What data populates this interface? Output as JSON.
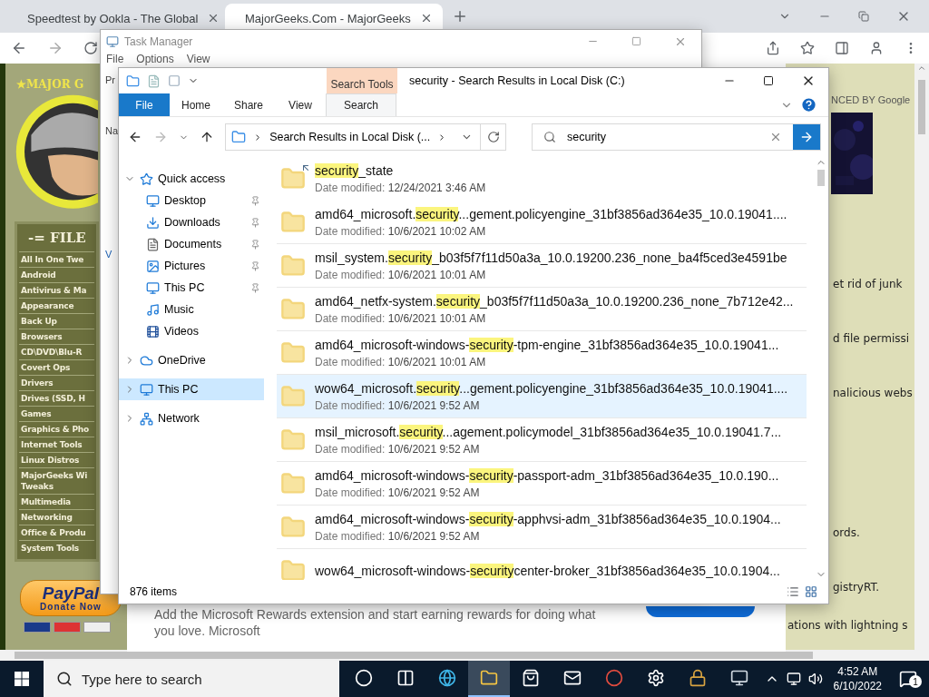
{
  "browser": {
    "tabs": [
      {
        "title": "Speedtest by Ookla - The Global",
        "selected": false
      },
      {
        "title": "MajorGeeks.Com - MajorGeeks",
        "selected": true
      }
    ]
  },
  "website": {
    "logo_text": "★MAJOR G",
    "menu_heading": "-= FILE",
    "categories": [
      "All In One Twe",
      "Android",
      "Antivirus & Ma",
      "Appearance",
      "Back Up",
      "Browsers",
      "CD\\DVD\\Blu-R",
      "Covert Ops",
      "Drivers",
      "Drives (SSD, H",
      "Games",
      "Graphics & Pho",
      "Internet Tools",
      "Linux Distros",
      "MajorGeeks Wi\nTweaks",
      "Multimedia",
      "Networking",
      "Office & Produ",
      "System Tools"
    ],
    "donate": {
      "brand": "PayPal",
      "label": "Donate Now"
    },
    "ad_label": "NCED BY Google",
    "snippets": [
      "et rid of junk",
      "d file permissi",
      "nalicious webs",
      "ords.",
      "gistryRT.",
      "ations with lightning s"
    ]
  },
  "rewards_banner": {
    "text": "Add the Microsoft Rewards extension and start earning rewards for doing what you love. Microsoft"
  },
  "task_manager": {
    "title": "Task Manager",
    "menu": [
      "File",
      "Options",
      "View"
    ],
    "fragments": [
      "Pr",
      "Na",
      "V"
    ]
  },
  "explorer": {
    "title": "security - Search Results in Local Disk (C:)",
    "context_tab": "Search Tools",
    "ribbon_tabs": [
      {
        "label": "File",
        "kind": "file",
        "selected": false
      },
      {
        "label": "Home",
        "kind": "tab",
        "selected": false
      },
      {
        "label": "Share",
        "kind": "tab",
        "selected": false
      },
      {
        "label": "View",
        "kind": "tab",
        "selected": false
      },
      {
        "label": "Search",
        "kind": "context",
        "selected": true
      }
    ],
    "address": "Search Results in Local Disk (...",
    "search": {
      "value": "security"
    },
    "nav": [
      {
        "label": "Quick access",
        "kind": "star",
        "expanded": true,
        "selected": false,
        "children": [
          {
            "label": "Desktop",
            "kind": "desktop",
            "pinned": true,
            "selected": false
          },
          {
            "label": "Downloads",
            "kind": "download",
            "pinned": true,
            "selected": false
          },
          {
            "label": "Documents",
            "kind": "document",
            "pinned": true,
            "selected": false
          },
          {
            "label": "Pictures",
            "kind": "picture",
            "pinned": true,
            "selected": false
          },
          {
            "label": "This PC",
            "kind": "pc",
            "pinned": true,
            "selected": false
          },
          {
            "label": "Music",
            "kind": "music",
            "pinned": false,
            "selected": false
          },
          {
            "label": "Videos",
            "kind": "video",
            "pinned": false,
            "selected": false
          }
        ]
      },
      {
        "label": "OneDrive",
        "kind": "cloud",
        "expanded": false,
        "selected": false
      },
      {
        "label": "This PC",
        "kind": "pc",
        "expanded": false,
        "selected": true
      },
      {
        "label": "Network",
        "kind": "network",
        "expanded": false,
        "selected": false
      }
    ],
    "files": [
      {
        "match": "security",
        "after": "_state",
        "date_label": "Date modified:",
        "date": "12/24/2021 3:46 AM",
        "kind": "shortcut",
        "selected": false
      },
      {
        "before": "amd64_microsoft.",
        "match": "security",
        "after": "...gement.policyengine_31bf3856ad364e35_10.0.19041....",
        "date_label": "Date modified:",
        "date": "10/6/2021 10:02 AM",
        "kind": "folder",
        "selected": false
      },
      {
        "before": "msil_system.",
        "match": "security",
        "after": "_b03f5f7f11d50a3a_10.0.19200.236_none_ba4f5ced3e4591be",
        "date_label": "Date modified:",
        "date": "10/6/2021 10:01 AM",
        "kind": "folder",
        "selected": false
      },
      {
        "before": "amd64_netfx-system.",
        "match": "security",
        "after": "_b03f5f7f11d50a3a_10.0.19200.236_none_7b712e42...",
        "date_label": "Date modified:",
        "date": "10/6/2021 10:01 AM",
        "kind": "folder",
        "selected": false
      },
      {
        "before": "amd64_microsoft-windows-",
        "match": "security",
        "after": "-tpm-engine_31bf3856ad364e35_10.0.19041...",
        "date_label": "Date modified:",
        "date": "10/6/2021 10:01 AM",
        "kind": "folder",
        "selected": false
      },
      {
        "before": "wow64_microsoft.",
        "match": "security",
        "after": "...gement.policyengine_31bf3856ad364e35_10.0.19041....",
        "date_label": "Date modified:",
        "date": "10/6/2021 9:52 AM",
        "kind": "folder",
        "selected": true
      },
      {
        "before": "msil_microsoft.",
        "match": "security",
        "after": "...agement.policymodel_31bf3856ad364e35_10.0.19041.7...",
        "date_label": "Date modified:",
        "date": "10/6/2021 9:52 AM",
        "kind": "folder",
        "selected": false
      },
      {
        "before": "amd64_microsoft-windows-",
        "match": "security",
        "after": "-passport-adm_31bf3856ad364e35_10.0.190...",
        "date_label": "Date modified:",
        "date": "10/6/2021 9:52 AM",
        "kind": "folder",
        "selected": false
      },
      {
        "before": "amd64_microsoft-windows-",
        "match": "security",
        "after": "-apphvsi-adm_31bf3856ad364e35_10.0.1904...",
        "date_label": "Date modified:",
        "date": "10/6/2021 9:52 AM",
        "kind": "folder",
        "selected": false
      },
      {
        "before": "wow64_microsoft-windows-",
        "match": "security",
        "after": "center-broker_31bf3856ad364e35_10.0.1904...",
        "kind": "folder",
        "selected": false
      }
    ],
    "status": "876 items"
  },
  "taskbar": {
    "search_placeholder": "Type here to search",
    "apps": [
      {
        "kind": "cortana",
        "active": false
      },
      {
        "kind": "taskview",
        "active": false
      },
      {
        "kind": "edge",
        "active": false
      },
      {
        "kind": "explorer",
        "active": true
      },
      {
        "kind": "store",
        "active": false
      },
      {
        "kind": "mail",
        "active": false
      },
      {
        "kind": "chrome",
        "active": false
      },
      {
        "kind": "settings",
        "active": false
      },
      {
        "kind": "lock",
        "active": false
      },
      {
        "kind": "monitor",
        "active": false
      }
    ],
    "time": "4:52 AM",
    "date": "6/10/2022",
    "notification_count": "1"
  }
}
